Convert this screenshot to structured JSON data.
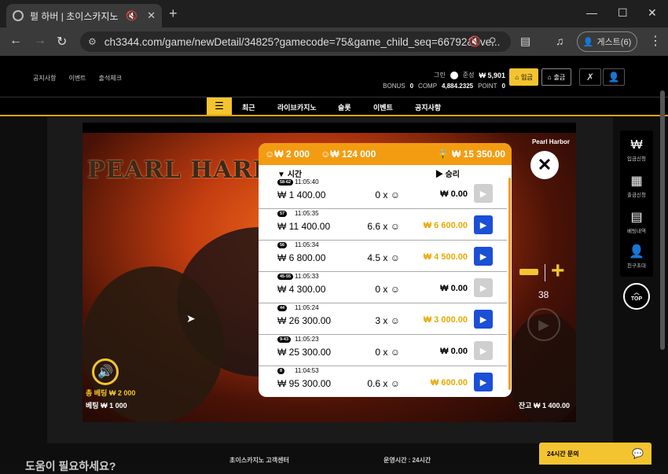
{
  "browser": {
    "tab_title": "펄 하버 | 초이스카지노",
    "url": "ch3344.com/game/newDetail/34825?gamecode=75&game_child_seq=66792&eve...",
    "guest_label": "게스트(6)"
  },
  "site": {
    "top_links": [
      "공지사항",
      "이벤트",
      "출석체크"
    ],
    "user": {
      "grade": "그린",
      "status": "준성",
      "balance": "₩ 5,901",
      "bonus_label": "BONUS",
      "bonus_value": "0",
      "comp_label": "COMP",
      "comp_value": "4,884.2325",
      "point_label": "POINT",
      "point_value": "0"
    },
    "deposit_label": "입금",
    "withdraw_label": "출금",
    "nav": [
      "최근",
      "라이브카지노",
      "슬롯",
      "이벤트",
      "공지사항"
    ]
  },
  "game": {
    "title_art": "PEARL HARBOR",
    "brand": "Pearl Harbor",
    "bet_top": "₩ 2 000",
    "total_top": "₩ 124 000",
    "locked_top": "₩ 15 350.00",
    "col_time": "시간",
    "col_win": "승리",
    "history": [
      {
        "badge": "58-62",
        "time": "11:05:40",
        "amount": "₩ 1 400.00",
        "mult": "0 x",
        "win": "₩ 0.00",
        "win_color": "#000000",
        "active": false
      },
      {
        "badge": "57",
        "time": "11:05:35",
        "amount": "₩ 11 400.00",
        "mult": "6.6 x",
        "win": "₩ 6 600.00",
        "win_color": "#e6a800",
        "active": true
      },
      {
        "badge": "56",
        "time": "11:05:34",
        "amount": "₩ 6 800.00",
        "mult": "4.5 x",
        "win": "₩ 4 500.00",
        "win_color": "#e6a800",
        "active": true
      },
      {
        "badge": "45-55",
        "time": "11:05:33",
        "amount": "₩ 4 300.00",
        "mult": "0 x",
        "win": "₩ 0.00",
        "win_color": "#000000",
        "active": false
      },
      {
        "badge": "44",
        "time": "11:05:24",
        "amount": "₩ 26 300.00",
        "mult": "3 x",
        "win": "₩ 3 000.00",
        "win_color": "#e6a800",
        "active": true
      },
      {
        "badge": "9-43",
        "time": "11:05:23",
        "amount": "₩ 25 300.00",
        "mult": "0 x",
        "win": "₩ 0.00",
        "win_color": "#000000",
        "active": false
      },
      {
        "badge": "8",
        "time": "11:04:53",
        "amount": "₩ 95 300.00",
        "mult": "0.6 x",
        "win": "₩ 600.00",
        "win_color": "#e6a800",
        "active": true
      }
    ],
    "level": "38",
    "total_bet_label": "총 베팅",
    "total_bet_value": "₩ 2 000",
    "bet_label": "베팅",
    "bet_value": "₩ 1 000",
    "balance_label": "잔고",
    "balance_value": "₩ 1 400.00"
  },
  "sidebar": {
    "items": [
      "입금신청",
      "출금신청",
      "베팅내역",
      "친구초대"
    ],
    "top_label": "TOP"
  },
  "chat": {
    "label": "24시간 문의"
  },
  "footer": {
    "texts": [
      "도움이 필요하세요?",
      "초이스카지노 고객센터",
      "운영시간 : 24시간"
    ]
  }
}
